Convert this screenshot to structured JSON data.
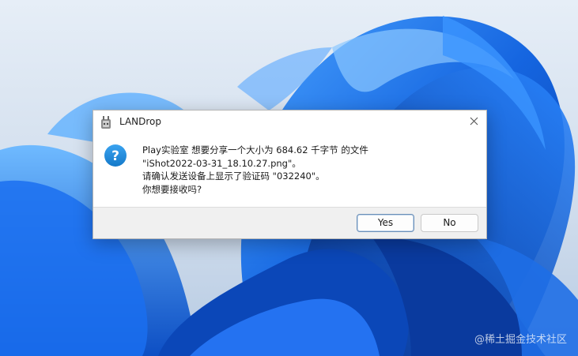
{
  "dialog": {
    "title": "LANDrop",
    "message_lines": [
      "Play实验室 想要分享一个大小为 684.62 千字节 的文件",
      "\"iShot2022-03-31_18.10.27.png\"。",
      "请确认发送设备上显示了验证码 \"032240\"。",
      "你想要接收吗?"
    ],
    "icons": {
      "app": "landrop-icon",
      "question": "question-icon",
      "close": "close-icon"
    },
    "buttons": {
      "yes": "Yes",
      "no": "No"
    }
  },
  "watermark": "@稀土掘金技术社区",
  "colors": {
    "wallpaper_blue": "#1565e0",
    "question_icon": "#1e88d6",
    "dialog_bg": "#ffffff",
    "footer_bg": "#f0f0f0"
  }
}
